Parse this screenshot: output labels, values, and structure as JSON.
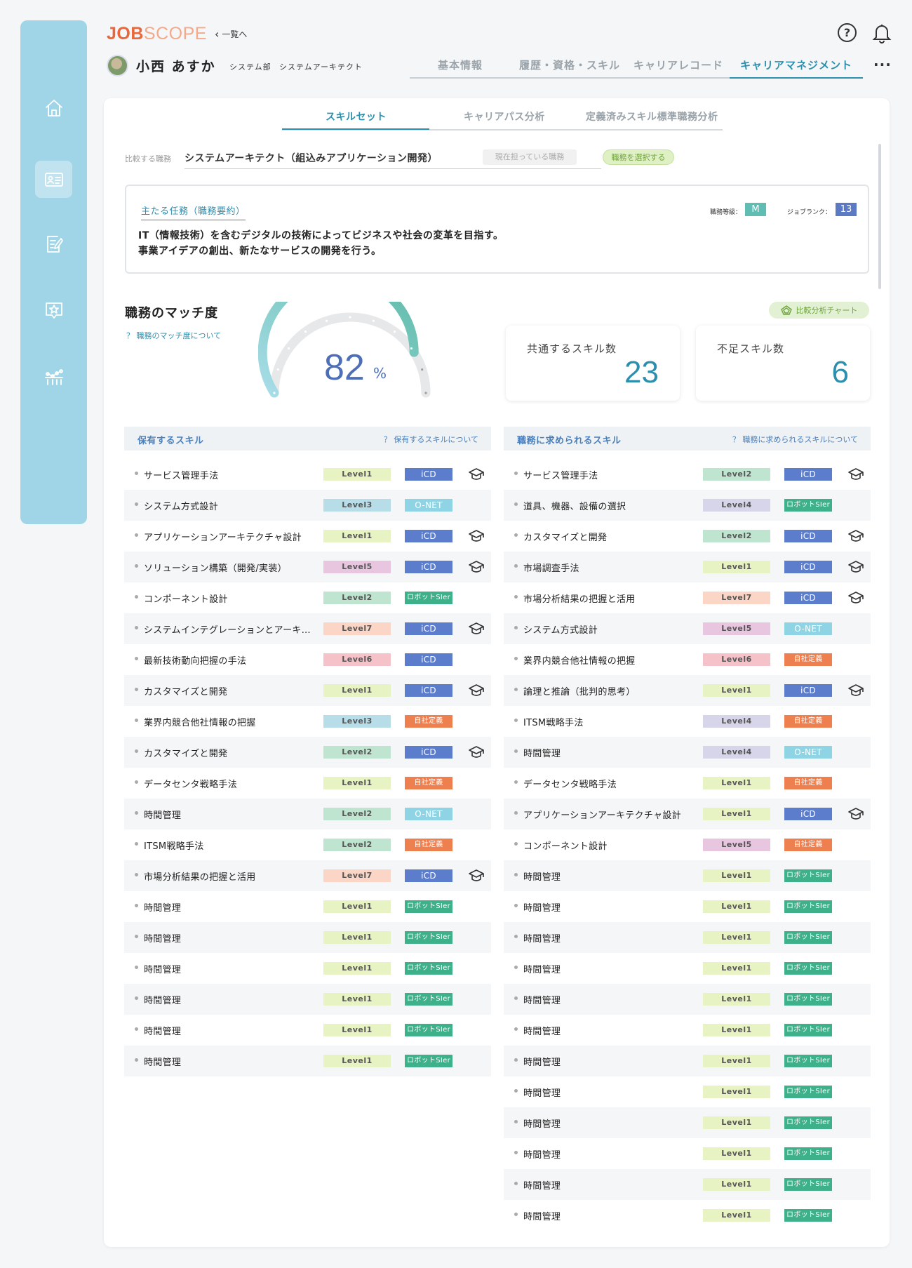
{
  "app": {
    "logo_part1": "JOB",
    "logo_part2": "SCOPE",
    "back_label": "一覧へ"
  },
  "user": {
    "name": "小西 あすか",
    "department": "システム部",
    "role": "システムアーキテクト"
  },
  "top_tabs": [
    {
      "label": "基本情報",
      "active": false
    },
    {
      "label": "履歴・資格・スキル",
      "active": false
    },
    {
      "label": "キャリアレコード",
      "active": false
    },
    {
      "label": "キャリアマネジメント",
      "active": true
    }
  ],
  "sub_tabs": [
    {
      "label": "スキルセット",
      "active": true
    },
    {
      "label": "キャリアパス分析",
      "active": false
    },
    {
      "label": "定義済みスキル標準職務分析",
      "active": false
    }
  ],
  "compare": {
    "label": "比較する職務",
    "value": "システムアーキテクト（組込みアプリケーション開発）",
    "current_button": "現在担っている職務",
    "select_button": "職務を選択する"
  },
  "duty": {
    "title": "主たる任務（職務要約）",
    "line1": "IT（情報技術）を含むデジタルの技術によってビジネスや社会の変革を目指す。",
    "line2": "事業アイデアの創出、新たなサービスの開発を行う。",
    "grade_label": "職務等級：",
    "grade_value": "M",
    "rank_label": "ジョブランク：",
    "rank_value": "13"
  },
  "match": {
    "title": "職務のマッチ度",
    "help": "職務のマッチ度について",
    "percent": 82,
    "percent_text": "82",
    "unit": "%",
    "chart_button": "比較分析チャート"
  },
  "stats": {
    "common_label": "共通するスキル数",
    "common_value": "23",
    "missing_label": "不足スキル数",
    "missing_value": "6"
  },
  "level_colors": {
    "Level1": "#e8f3c4",
    "Level2": "#bfe5d0",
    "Level3": "#b6dde8",
    "Level4": "#d6d5e9",
    "Level5": "#e8c6e0",
    "Level6": "#f4c2c8",
    "Level7": "#fbd6c6"
  },
  "owned": {
    "title": "保有するスキル",
    "help": "保有するスキルについて",
    "rows": [
      {
        "name": "サービス管理手法",
        "level": "Level1",
        "source": "iCD",
        "src_type": "icd",
        "hat": true
      },
      {
        "name": "システム方式設計",
        "level": "Level3",
        "source": "O-NET",
        "src_type": "onet",
        "hat": false
      },
      {
        "name": "アプリケーションアーキテクチャ設計",
        "level": "Level1",
        "source": "iCD",
        "src_type": "icd",
        "hat": true
      },
      {
        "name": "ソリューション構築（開発/実装）",
        "level": "Level5",
        "source": "iCD",
        "src_type": "icd",
        "hat": true
      },
      {
        "name": "コンポーネント設計",
        "level": "Level2",
        "source": "ロボットSIer",
        "src_type": "robot",
        "hat": false
      },
      {
        "name": "システムインテグレーションとアーキテクチャ",
        "level": "Level7",
        "source": "iCD",
        "src_type": "icd",
        "hat": true
      },
      {
        "name": "最新技術動向把握の手法",
        "level": "Level6",
        "source": "iCD",
        "src_type": "icd",
        "hat": false
      },
      {
        "name": "カスタマイズと開発",
        "level": "Level1",
        "source": "iCD",
        "src_type": "icd",
        "hat": true
      },
      {
        "name": "業界内競合他社情報の把握",
        "level": "Level3",
        "source": "自社定義",
        "src_type": "own",
        "hat": false
      },
      {
        "name": "カスタマイズと開発",
        "level": "Level2",
        "source": "iCD",
        "src_type": "icd",
        "hat": true
      },
      {
        "name": "データセンタ戦略手法",
        "level": "Level1",
        "source": "自社定義",
        "src_type": "own",
        "hat": false
      },
      {
        "name": "時間管理",
        "level": "Level2",
        "source": "O-NET",
        "src_type": "onet",
        "hat": false
      },
      {
        "name": "ITSM戦略手法",
        "level": "Level2",
        "source": "自社定義",
        "src_type": "own",
        "hat": false
      },
      {
        "name": "市場分析結果の把握と活用",
        "level": "Level7",
        "source": "iCD",
        "src_type": "icd",
        "hat": true
      },
      {
        "name": "時間管理",
        "level": "Level1",
        "source": "ロボットSIer",
        "src_type": "robot",
        "hat": false
      },
      {
        "name": "時間管理",
        "level": "Level1",
        "source": "ロボットSIer",
        "src_type": "robot",
        "hat": false
      },
      {
        "name": "時間管理",
        "level": "Level1",
        "source": "ロボットSIer",
        "src_type": "robot",
        "hat": false
      },
      {
        "name": "時間管理",
        "level": "Level1",
        "source": "ロボットSIer",
        "src_type": "robot",
        "hat": false
      },
      {
        "name": "時間管理",
        "level": "Level1",
        "source": "ロボットSIer",
        "src_type": "robot",
        "hat": false
      },
      {
        "name": "時間管理",
        "level": "Level1",
        "source": "ロボットSIer",
        "src_type": "robot",
        "hat": false
      }
    ]
  },
  "required": {
    "title": "職務に求められるスキル",
    "help": "職務に求められるスキルについて",
    "rows": [
      {
        "name": "サービス管理手法",
        "level": "Level2",
        "source": "iCD",
        "src_type": "icd",
        "hat": true
      },
      {
        "name": "道具、機器、設備の選択",
        "level": "Level4",
        "source": "ロボットSIer",
        "src_type": "robot",
        "hat": false
      },
      {
        "name": "カスタマイズと開発",
        "level": "Level2",
        "source": "iCD",
        "src_type": "icd",
        "hat": true
      },
      {
        "name": "市場調査手法",
        "level": "Level1",
        "source": "iCD",
        "src_type": "icd",
        "hat": true
      },
      {
        "name": "市場分析結果の把握と活用",
        "level": "Level7",
        "source": "iCD",
        "src_type": "icd",
        "hat": true
      },
      {
        "name": "システム方式設計",
        "level": "Level5",
        "source": "O-NET",
        "src_type": "onet",
        "hat": false
      },
      {
        "name": "業界内競合他社情報の把握",
        "level": "Level6",
        "source": "自社定義",
        "src_type": "own",
        "hat": false
      },
      {
        "name": "論理と推論（批判的思考）",
        "level": "Level1",
        "source": "iCD",
        "src_type": "icd",
        "hat": true
      },
      {
        "name": "ITSM戦略手法",
        "level": "Level4",
        "source": "自社定義",
        "src_type": "own",
        "hat": false
      },
      {
        "name": "時間管理",
        "level": "Level4",
        "source": "O-NET",
        "src_type": "onet",
        "hat": false
      },
      {
        "name": "データセンタ戦略手法",
        "level": "Level1",
        "source": "自社定義",
        "src_type": "own",
        "hat": false
      },
      {
        "name": "アプリケーションアーキテクチャ設計",
        "level": "Level1",
        "source": "iCD",
        "src_type": "icd",
        "hat": true
      },
      {
        "name": "コンポーネント設計",
        "level": "Level5",
        "source": "自社定義",
        "src_type": "own",
        "hat": false
      },
      {
        "name": "時間管理",
        "level": "Level1",
        "source": "ロボットSIer",
        "src_type": "robot",
        "hat": false
      },
      {
        "name": "時間管理",
        "level": "Level1",
        "source": "ロボットSIer",
        "src_type": "robot",
        "hat": false
      },
      {
        "name": "時間管理",
        "level": "Level1",
        "source": "ロボットSIer",
        "src_type": "robot",
        "hat": false
      },
      {
        "name": "時間管理",
        "level": "Level1",
        "source": "ロボットSIer",
        "src_type": "robot",
        "hat": false
      },
      {
        "name": "時間管理",
        "level": "Level1",
        "source": "ロボットSIer",
        "src_type": "robot",
        "hat": false
      },
      {
        "name": "時間管理",
        "level": "Level1",
        "source": "ロボットSIer",
        "src_type": "robot",
        "hat": false
      },
      {
        "name": "時間管理",
        "level": "Level1",
        "source": "ロボットSIer",
        "src_type": "robot",
        "hat": false
      },
      {
        "name": "時間管理",
        "level": "Level1",
        "source": "ロボットSIer",
        "src_type": "robot",
        "hat": false
      },
      {
        "name": "時間管理",
        "level": "Level1",
        "source": "ロボットSIer",
        "src_type": "robot",
        "hat": false
      },
      {
        "name": "時間管理",
        "level": "Level1",
        "source": "ロボットSIer",
        "src_type": "robot",
        "hat": false
      },
      {
        "name": "時間管理",
        "level": "Level1",
        "source": "ロボットSIer",
        "src_type": "robot",
        "hat": false
      },
      {
        "name": "時間管理",
        "level": "Level1",
        "source": "ロボットSIer",
        "src_type": "robot",
        "hat": false
      }
    ]
  },
  "icons": {
    "sidebar": [
      "home-icon",
      "profile-card-icon",
      "edit-document-icon",
      "star-badge-icon",
      "analytics-icon"
    ],
    "header": [
      "chevron-left-icon",
      "help-icon",
      "bell-icon",
      "more-icon"
    ],
    "skills": [
      "graduation-cap-icon"
    ]
  }
}
